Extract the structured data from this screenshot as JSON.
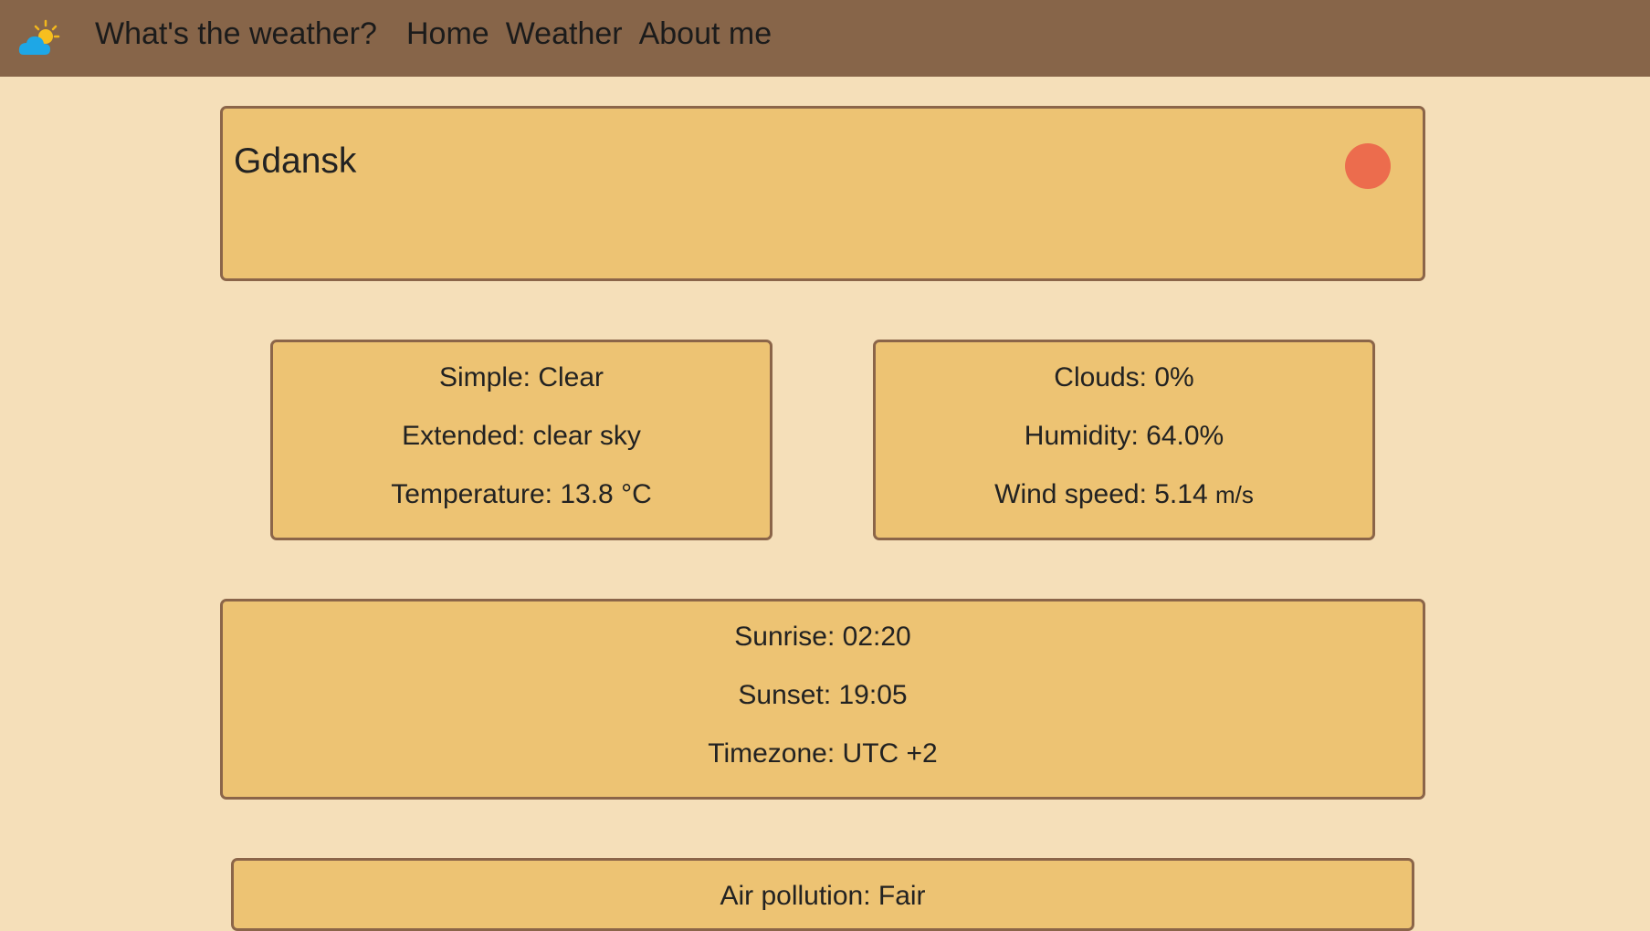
{
  "nav": {
    "brand": "What's the weather?",
    "links": [
      "Home",
      "Weather",
      "About me"
    ],
    "logo_icon": "weather-partly-sunny-icon"
  },
  "city": {
    "name": "Gdansk",
    "status_color": "#ec6c4d"
  },
  "conditions": {
    "simple": "Simple: Clear",
    "extended": "Extended: clear sky",
    "temperature": "Temperature: 13.8 °C"
  },
  "metrics": {
    "clouds": "Clouds: 0%",
    "humidity": "Humidity: 64.0%",
    "wind_speed_label": "Wind speed: 5.14 ",
    "wind_speed_unit": "m/s"
  },
  "sun": {
    "sunrise": "Sunrise: 02:20",
    "sunset": "Sunset: 19:05",
    "timezone": "Timezone: UTC +2"
  },
  "pollution": {
    "label": "Air pollution: Fair"
  },
  "colors": {
    "navbar": "#876549",
    "background": "#f5dfb9",
    "card": "#edc373",
    "card_border": "#8b6549"
  }
}
